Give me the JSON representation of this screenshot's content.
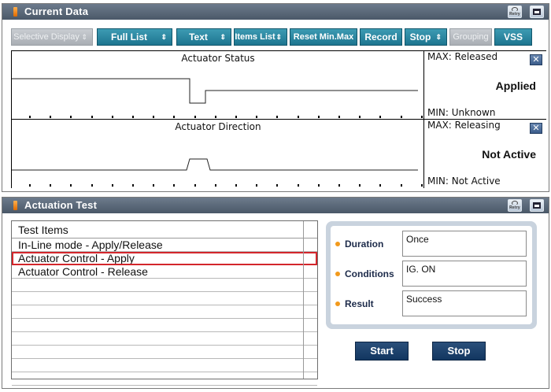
{
  "current_data": {
    "title": "Current Data",
    "retry_label": "Retry",
    "toolbar": {
      "selective_display": "Selective Display",
      "full_list": "Full List",
      "text": "Text",
      "items_list": "Items List",
      "reset_min_max": "Reset Min.Max",
      "record": "Record",
      "stop": "Stop",
      "grouping": "Grouping",
      "vss": "VSS",
      "arrow_glyph": "⇕"
    },
    "graphs": [
      {
        "title": "Actuator Status",
        "max_label": "MAX: Released",
        "value": "Applied",
        "min_label": "MIN: Unknown",
        "close_label": "✕"
      },
      {
        "title": "Actuator Direction",
        "max_label": "MAX: Releasing",
        "value": "Not Active",
        "min_label": "MIN: Not Active",
        "close_label": "✕"
      }
    ]
  },
  "actuation_test": {
    "title": "Actuation Test",
    "retry_label": "Retry",
    "table_header": "Test Items",
    "items": [
      "In-Line mode - Apply/Release",
      "Actuator Control - Apply",
      "Actuator Control - Release"
    ],
    "selected_index": 1,
    "fields": {
      "duration_label": "Duration",
      "duration_value": "Once",
      "conditions_label": "Conditions",
      "conditions_value": "IG. ON",
      "result_label": "Result",
      "result_value": "Success"
    },
    "start_label": "Start",
    "stop_label": "Stop"
  },
  "colors": {
    "titlebar": "#4a5868",
    "toolbar_button": "#1d7590",
    "selection_outline": "#d3262b",
    "action_button": "#123660",
    "bullet": "#f29a1c"
  }
}
